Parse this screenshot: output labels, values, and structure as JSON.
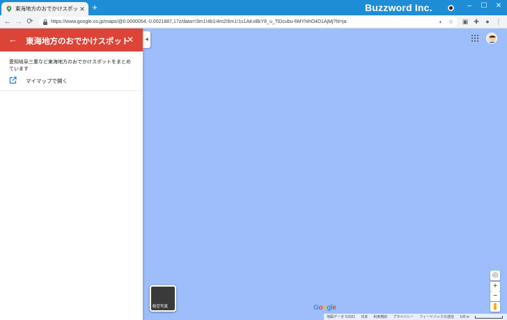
{
  "browser": {
    "tab_title": "東海地方のおでかけスポット - Goog",
    "url": "https://www.google.co.jp/maps/@0.0000054,-0.0021887,17z/data=!3m1!4b1!4m2!6m1!1s1AKxBkY8_u_TiDcubu-6MYhihO4D1AjMj?hl=ja",
    "brand": "Buzzword Inc.",
    "icons": {
      "favicon": "maps-pin-icon",
      "tab_close": "close-icon",
      "new_tab": "plus-icon",
      "back": "arrow-left-icon",
      "forward": "arrow-right-icon",
      "reload": "reload-icon",
      "lock": "lock-icon",
      "translate": "translate-icon",
      "bookmark": "star-icon",
      "extension_a": "extension-icon",
      "extensions": "puzzle-icon",
      "profile": "person-icon",
      "menu": "kebab-menu-icon"
    }
  },
  "panel": {
    "title": "東海地方のおでかけスポット",
    "description": "愛知岐阜三重など東海地方のおでかけスポットをまとめています",
    "open_in_mymaps": "マイマップで開く",
    "header_color": "#db4437"
  },
  "map": {
    "background_color": "#9ebefb",
    "layer_label": "航空写真",
    "logo": "Google",
    "footer": {
      "map_data": "地図データ ©2021",
      "country": "日本",
      "terms": "利用規約",
      "privacy": "プライバシー",
      "feedback": "フィードバックの送信",
      "scale": "100 m"
    },
    "controls": {
      "zoom_in": "+",
      "zoom_out": "−"
    }
  }
}
